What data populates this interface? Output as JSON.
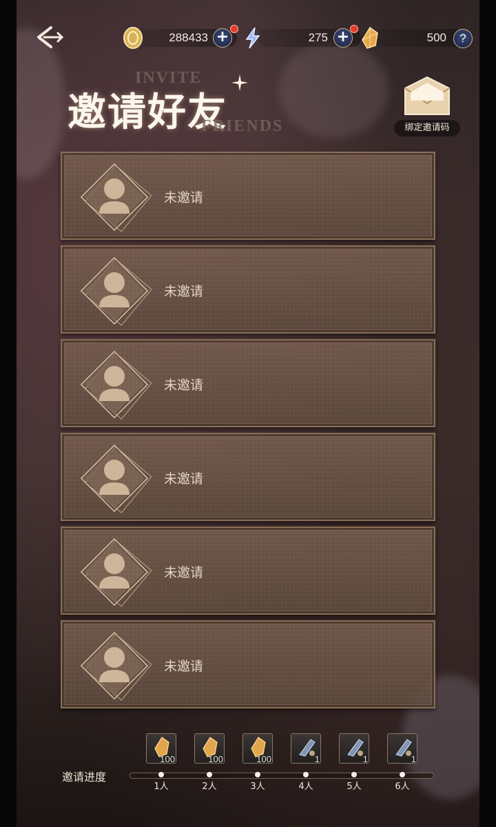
{
  "header": {
    "coins": "288433",
    "energy": "275",
    "crystals": "500",
    "help_label": "?"
  },
  "title": {
    "cn": "邀请好友",
    "en_line1": "INVITE",
    "en_line2": "FRIENDS"
  },
  "bind_code": {
    "label": "绑定邀请码"
  },
  "invite_slots": [
    {
      "status": "未邀请"
    },
    {
      "status": "未邀请"
    },
    {
      "status": "未邀请"
    },
    {
      "status": "未邀请"
    },
    {
      "status": "未邀请"
    },
    {
      "status": "未邀请"
    }
  ],
  "progress": {
    "label": "邀请进度",
    "milestones": [
      {
        "label": "1人",
        "reward_icon": "crystal-icon",
        "reward_qty": "100"
      },
      {
        "label": "2人",
        "reward_icon": "crystal-icon",
        "reward_qty": "100"
      },
      {
        "label": "3人",
        "reward_icon": "crystal-icon",
        "reward_qty": "100"
      },
      {
        "label": "4人",
        "reward_icon": "item-icon",
        "reward_qty": "1"
      },
      {
        "label": "5人",
        "reward_icon": "item-icon",
        "reward_qty": "1"
      },
      {
        "label": "6人",
        "reward_icon": "item-icon",
        "reward_qty": "1"
      }
    ]
  },
  "colors": {
    "accent_gold": "#c9b893",
    "slot_border": "#8a6e56",
    "notification": "#e33a2a"
  }
}
